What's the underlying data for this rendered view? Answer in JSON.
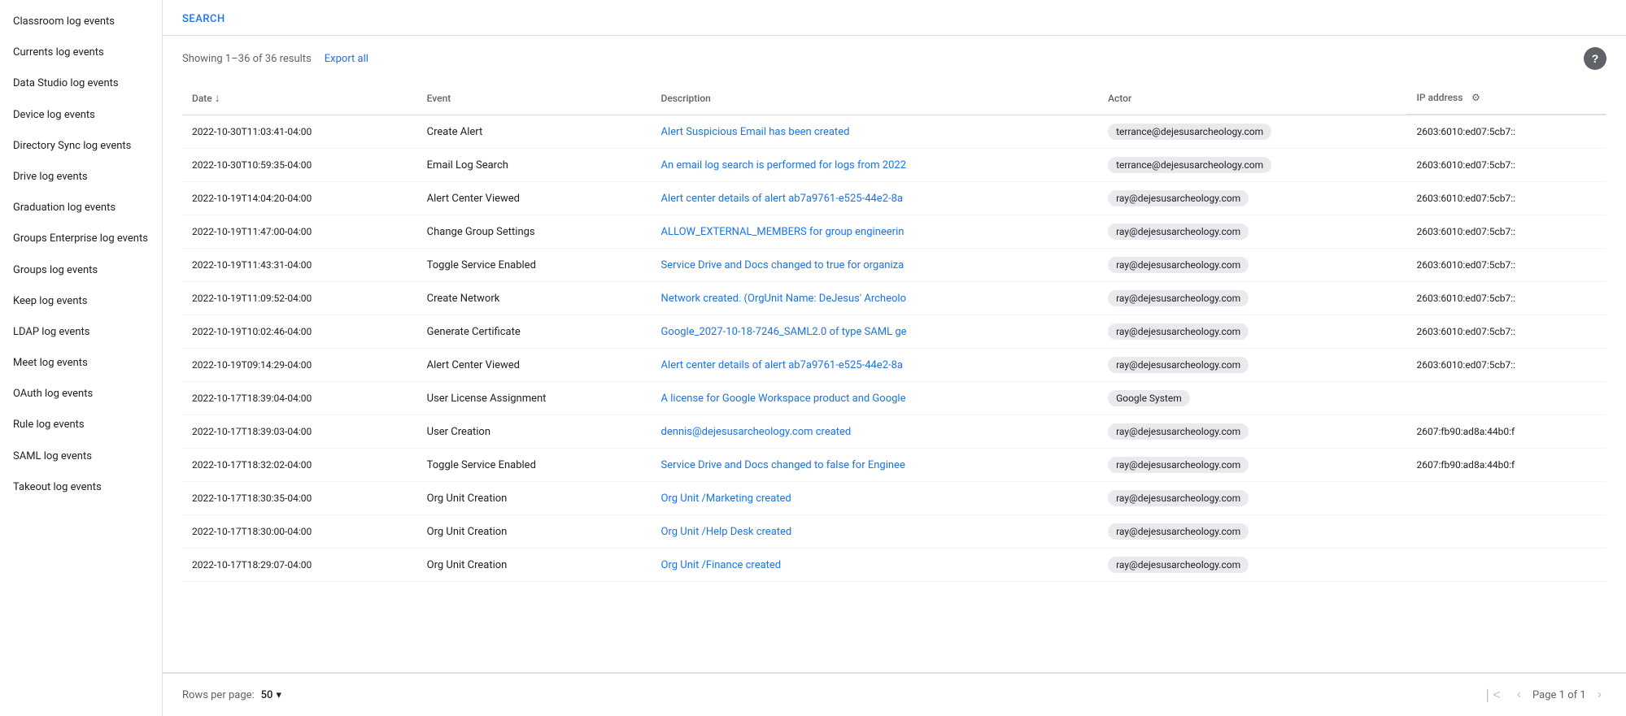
{
  "sidebar": {
    "items": [
      {
        "id": "classroom",
        "label": "Classroom log events",
        "active": false
      },
      {
        "id": "currents",
        "label": "Currents log events",
        "active": false
      },
      {
        "id": "datastudio",
        "label": "Data Studio log events",
        "active": false
      },
      {
        "id": "device",
        "label": "Device log events",
        "active": false
      },
      {
        "id": "directorysync",
        "label": "Directory Sync log events",
        "active": false
      },
      {
        "id": "drive",
        "label": "Drive log events",
        "active": false
      },
      {
        "id": "graduation",
        "label": "Graduation log events",
        "active": false
      },
      {
        "id": "groupsenterprise",
        "label": "Groups Enterprise log events",
        "active": false
      },
      {
        "id": "groups",
        "label": "Groups log events",
        "active": false
      },
      {
        "id": "keep",
        "label": "Keep log events",
        "active": false
      },
      {
        "id": "ldap",
        "label": "LDAP log events",
        "active": false
      },
      {
        "id": "meet",
        "label": "Meet log events",
        "active": false
      },
      {
        "id": "oauth",
        "label": "OAuth log events",
        "active": false
      },
      {
        "id": "rule",
        "label": "Rule log events",
        "active": false
      },
      {
        "id": "saml",
        "label": "SAML log events",
        "active": false
      },
      {
        "id": "takeout",
        "label": "Takeout log events",
        "active": false
      }
    ]
  },
  "search": {
    "label": "SEARCH"
  },
  "results": {
    "summary": "Showing 1–36 of 36 results",
    "export_label": "Export all",
    "help_label": "?"
  },
  "table": {
    "columns": [
      {
        "id": "date",
        "label": "Date",
        "sortable": true
      },
      {
        "id": "event",
        "label": "Event",
        "sortable": false
      },
      {
        "id": "description",
        "label": "Description",
        "sortable": false
      },
      {
        "id": "actor",
        "label": "Actor",
        "sortable": false
      },
      {
        "id": "ip",
        "label": "IP address",
        "sortable": false
      }
    ],
    "rows": [
      {
        "date": "2022-10-30T11:03:41-04:00",
        "event": "Create Alert",
        "description": "Alert Suspicious Email has been created",
        "actor": "terrance@dejesusarcheology.com",
        "actor_type": "badge",
        "ip": "2603:6010:ed07:5cb7::"
      },
      {
        "date": "2022-10-30T10:59:35-04:00",
        "event": "Email Log Search",
        "description": "An email log search is performed for logs from 2022",
        "actor": "terrance@dejesusarcheology.com",
        "actor_type": "badge",
        "ip": "2603:6010:ed07:5cb7::"
      },
      {
        "date": "2022-10-19T14:04:20-04:00",
        "event": "Alert Center Viewed",
        "description": "Alert center details of alert ab7a9761-e525-44e2-8a",
        "actor": "ray@dejesusarcheology.com",
        "actor_type": "badge",
        "ip": "2603:6010:ed07:5cb7::"
      },
      {
        "date": "2022-10-19T11:47:00-04:00",
        "event": "Change Group Settings",
        "description": "ALLOW_EXTERNAL_MEMBERS for group engineerin",
        "actor": "ray@dejesusarcheology.com",
        "actor_type": "badge",
        "ip": "2603:6010:ed07:5cb7::"
      },
      {
        "date": "2022-10-19T11:43:31-04:00",
        "event": "Toggle Service Enabled",
        "description": "Service Drive and Docs changed to true for organiza",
        "actor": "ray@dejesusarcheology.com",
        "actor_type": "badge",
        "ip": "2603:6010:ed07:5cb7::"
      },
      {
        "date": "2022-10-19T11:09:52-04:00",
        "event": "Create Network",
        "description": "Network created. (OrgUnit Name: DeJesus' Archeolo",
        "actor": "ray@dejesusarcheology.com",
        "actor_type": "badge",
        "ip": "2603:6010:ed07:5cb7::"
      },
      {
        "date": "2022-10-19T10:02:46-04:00",
        "event": "Generate Certificate",
        "description": "Google_2027-10-18-7246_SAML2.0 of type SAML ge",
        "actor": "ray@dejesusarcheology.com",
        "actor_type": "badge",
        "ip": "2603:6010:ed07:5cb7::"
      },
      {
        "date": "2022-10-19T09:14:29-04:00",
        "event": "Alert Center Viewed",
        "description": "Alert center details of alert ab7a9761-e525-44e2-8a",
        "actor": "ray@dejesusarcheology.com",
        "actor_type": "badge",
        "ip": "2603:6010:ed07:5cb7::"
      },
      {
        "date": "2022-10-17T18:39:04-04:00",
        "event": "User License Assignment",
        "description": "A license for Google Workspace product and Google",
        "actor": "Google System",
        "actor_type": "badge",
        "ip": ""
      },
      {
        "date": "2022-10-17T18:39:03-04:00",
        "event": "User Creation",
        "description": "dennis@dejesusarcheology.com created",
        "actor": "ray@dejesusarcheology.com",
        "actor_type": "badge",
        "ip": "2607:fb90:ad8a:44b0:f"
      },
      {
        "date": "2022-10-17T18:32:02-04:00",
        "event": "Toggle Service Enabled",
        "description": "Service Drive and Docs changed to false for Enginee",
        "actor": "ray@dejesusarcheology.com",
        "actor_type": "badge",
        "ip": "2607:fb90:ad8a:44b0:f"
      },
      {
        "date": "2022-10-17T18:30:35-04:00",
        "event": "Org Unit Creation",
        "description": "Org Unit /Marketing created",
        "actor": "ray@dejesusarcheology.com",
        "actor_type": "badge",
        "ip": ""
      },
      {
        "date": "2022-10-17T18:30:00-04:00",
        "event": "Org Unit Creation",
        "description": "Org Unit /Help Desk created",
        "actor": "ray@dejesusarcheology.com",
        "actor_type": "badge",
        "ip": ""
      },
      {
        "date": "2022-10-17T18:29:07-04:00",
        "event": "Org Unit Creation",
        "description": "Org Unit /Finance created",
        "actor": "ray@dejesusarcheology.com",
        "actor_type": "badge",
        "ip": ""
      }
    ]
  },
  "footer": {
    "rows_per_page_label": "Rows per page:",
    "rows_per_page_value": "50",
    "page_info": "Page 1 of 1"
  }
}
